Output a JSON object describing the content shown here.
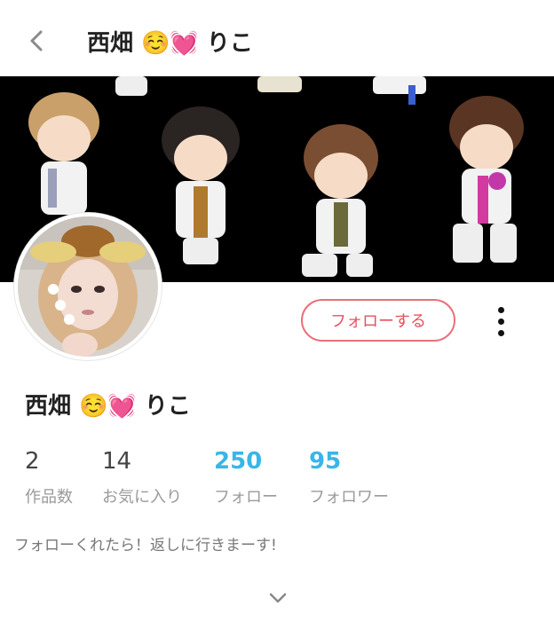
{
  "header": {
    "title": "西畑 ☺️💓 りこ",
    "back_icon": "chevron-left-icon"
  },
  "profile": {
    "name": "西畑 ☺️💓 りこ",
    "follow_button_label": "フォローする",
    "more_icon": "vertical-ellipsis-icon",
    "stats": [
      {
        "value": "2",
        "label": "作品数"
      },
      {
        "value": "14",
        "label": "お気に入り"
      },
      {
        "value": "250",
        "label": "フォロー"
      },
      {
        "value": "95",
        "label": "フォロワー"
      }
    ],
    "bio": "フォローくれたら！返しに行きまーす!",
    "expand_icon": "chevron-down-icon"
  },
  "colors": {
    "accent_red": "#e8505f",
    "accent_blue": "#39b6e8",
    "banner_bg": "#000000"
  }
}
